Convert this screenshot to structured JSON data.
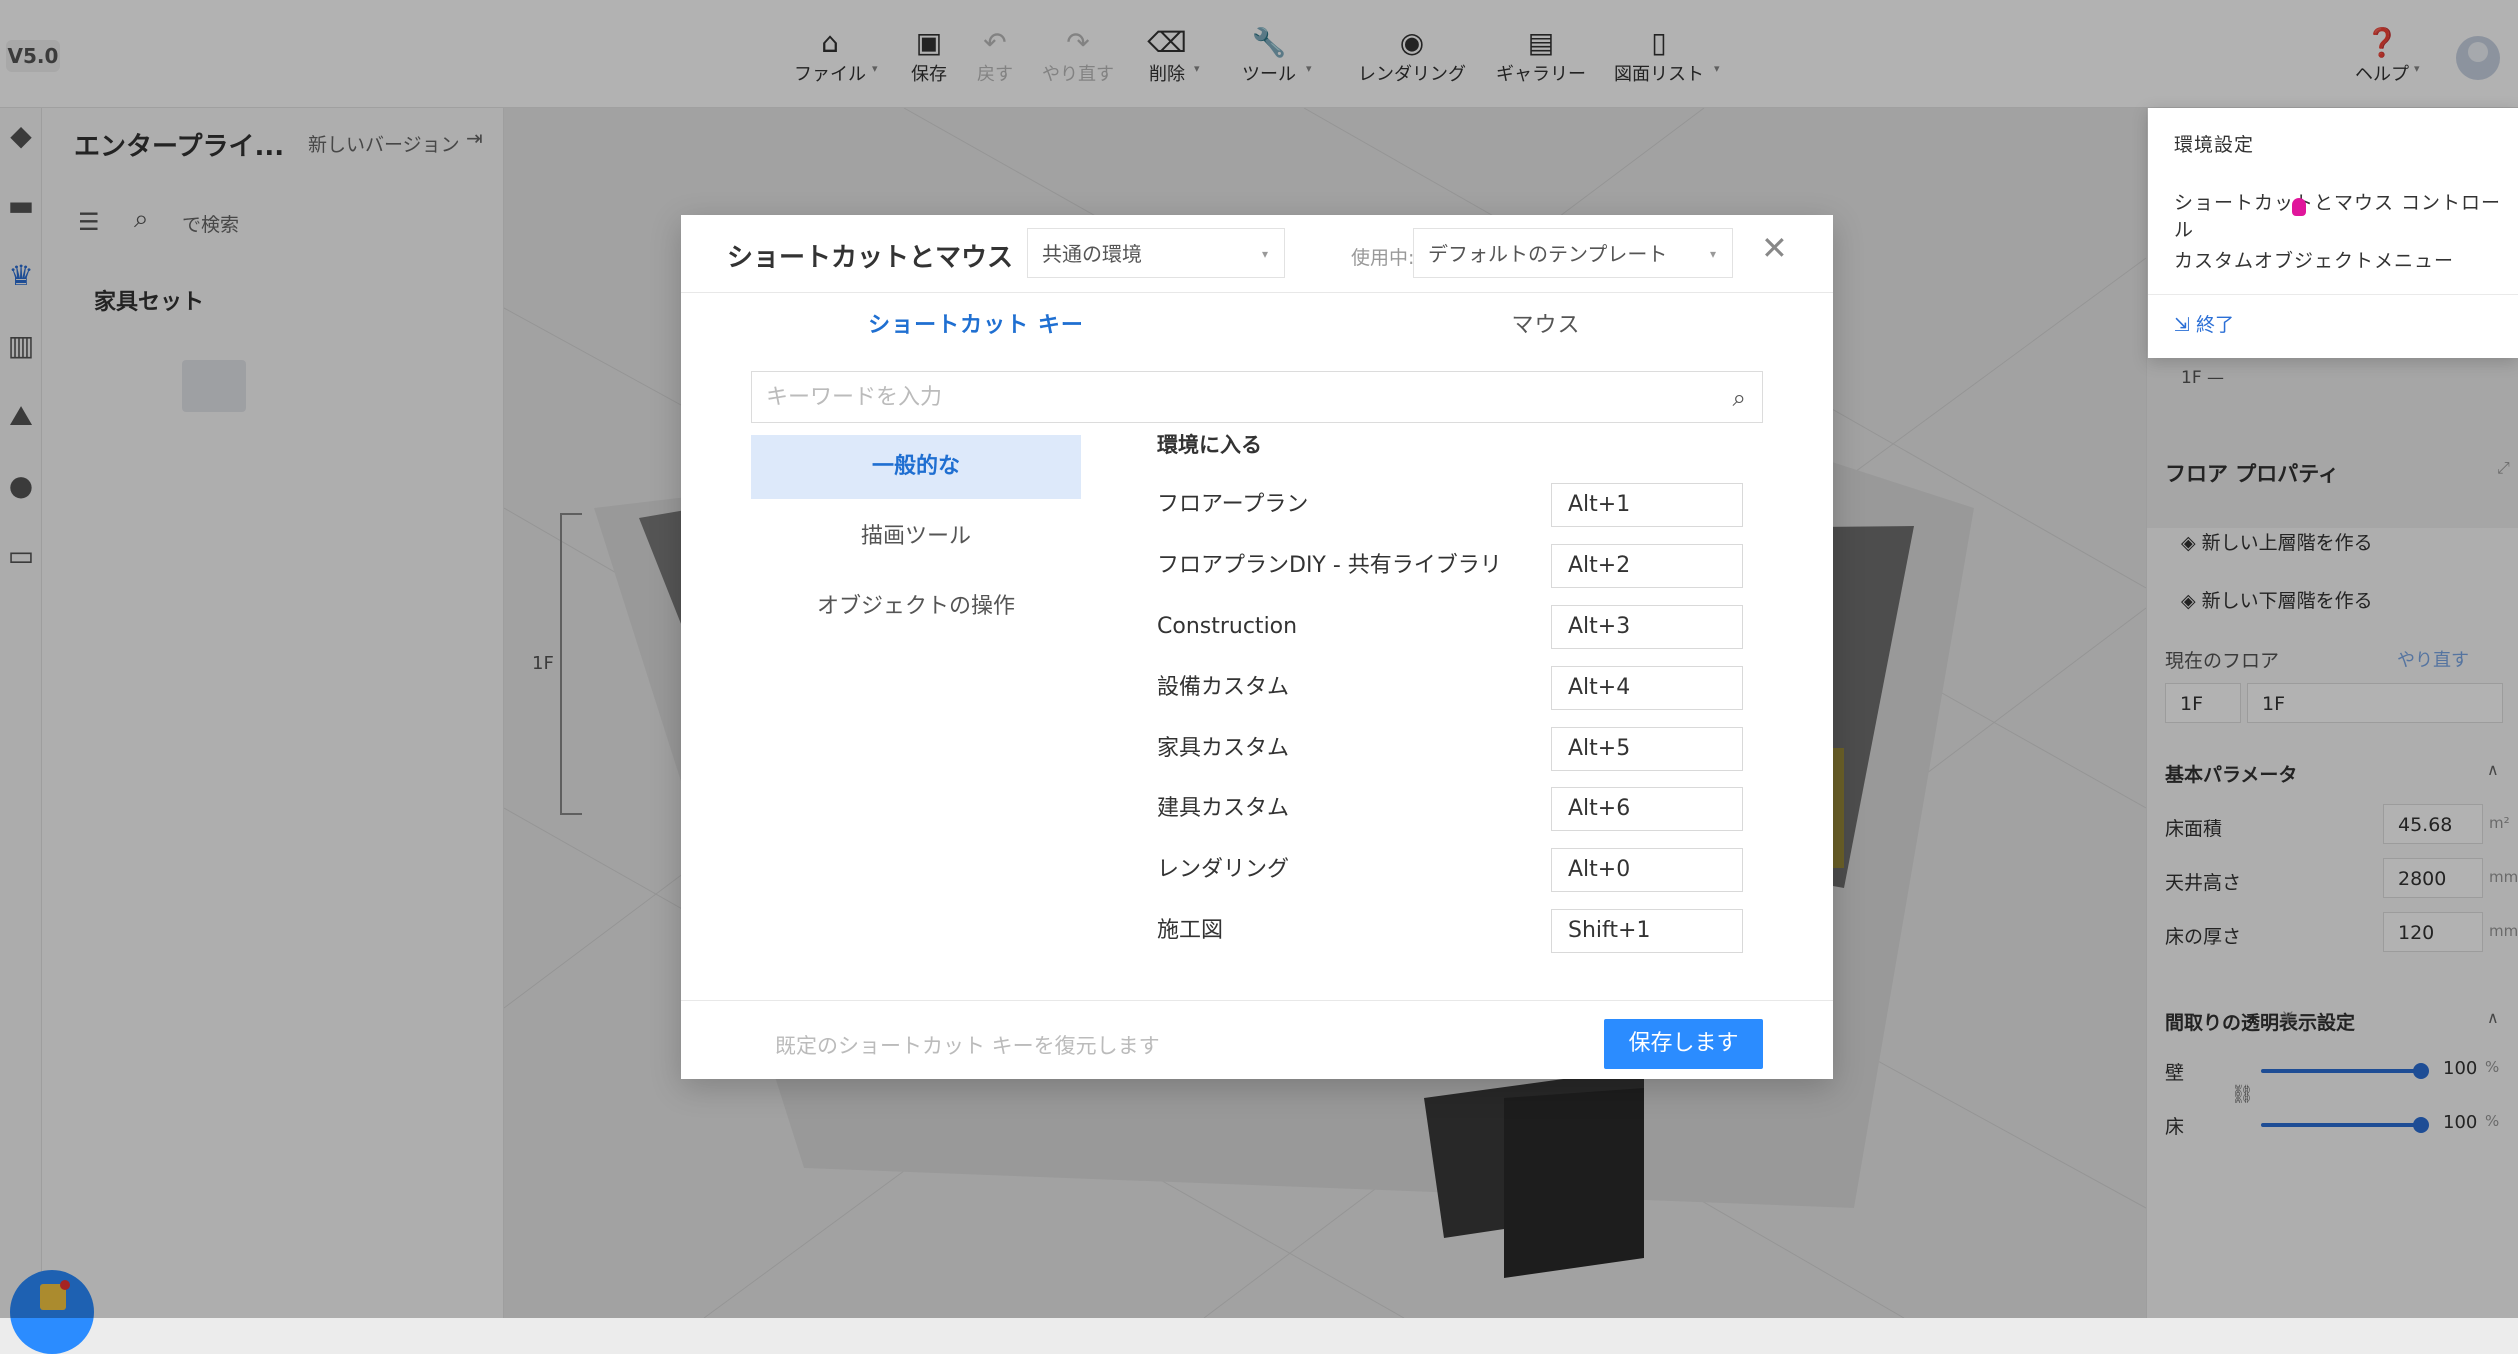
{
  "app": {
    "version": "V5.0"
  },
  "toolbar": {
    "items": [
      {
        "label": "ファイル",
        "icon": "home-icon",
        "enabled": true
      },
      {
        "label": "保存",
        "icon": "save-icon",
        "enabled": true
      },
      {
        "label": "戻す",
        "icon": "undo-icon",
        "enabled": false
      },
      {
        "label": "やり直す",
        "icon": "redo-icon",
        "enabled": false
      },
      {
        "label": "削除",
        "icon": "eraser-icon",
        "enabled": true
      },
      {
        "label": "ツール",
        "icon": "wrench-icon",
        "enabled": true
      },
      {
        "label": "レンダリング",
        "icon": "camera-icon",
        "enabled": true
      },
      {
        "label": "ギャラリー",
        "icon": "gallery-icon",
        "enabled": true
      },
      {
        "label": "図面リスト",
        "icon": "drawing-list-icon",
        "enabled": true
      }
    ],
    "help_label": "ヘルプ"
  },
  "left_panel": {
    "title": "エンタープライ...",
    "new_version": "新しいバージョン",
    "search_placeholder": "で検索",
    "section_title": "家具セット"
  },
  "canvas": {
    "floor_label": "1F"
  },
  "right_panel": {
    "level_label": "1F —",
    "floor_properties_title": "フロア プロパティ",
    "add_upper_floor": "新しい上層階を作る",
    "add_lower_floor": "新しい下層階を作る",
    "current_floor_label": "現在のフロア",
    "redo_label": "やり直す",
    "floor_select": "1F",
    "floor_name": "1F",
    "basic_params_title": "基本パラメータ",
    "params": [
      {
        "label": "床面積",
        "value": "45.68",
        "unit": "m²"
      },
      {
        "label": "天井高さ",
        "value": "2800",
        "unit": "mm"
      },
      {
        "label": "床の厚さ",
        "value": "120",
        "unit": "mm"
      }
    ],
    "transparency_title": "間取りの透明表示設定",
    "transparency_flag": "Y",
    "transparency": [
      {
        "label": "壁",
        "value": "100",
        "unit": "%",
        "level": 1.0
      },
      {
        "label": "床",
        "value": "100",
        "unit": "%",
        "level": 1.0
      }
    ]
  },
  "help_menu": {
    "items": [
      "環境設定",
      "ショートカットとマウス コントロール",
      "カスタムオブジェクトメニュー"
    ],
    "exit_label": "終了"
  },
  "modal": {
    "title": "ショートカットとマウス",
    "environment_select": "共通の環境",
    "in_use_label": "使用中:",
    "template_select": "デフォルトのテンプレート",
    "tabs": [
      "ショートカット キー",
      "マウス"
    ],
    "active_tab": 0,
    "search_placeholder": "キーワードを入力",
    "categories": [
      "一般的な",
      "描画ツール",
      "オブジェクトの操作"
    ],
    "active_category": 0,
    "section_title": "環境に入る",
    "shortcuts": [
      {
        "label": "フロアープラン",
        "key": "Alt+1"
      },
      {
        "label": "フロアプランDIY - 共有ライブラリ",
        "key": "Alt+2"
      },
      {
        "label": "Construction",
        "key": "Alt+3"
      },
      {
        "label": "設備カスタム",
        "key": "Alt+4"
      },
      {
        "label": "家具カスタム",
        "key": "Alt+5"
      },
      {
        "label": "建具カスタム",
        "key": "Alt+6"
      },
      {
        "label": "レンダリング",
        "key": "Alt+0"
      },
      {
        "label": "施工図",
        "key": "Shift+1"
      }
    ],
    "restore_label": "既定のショートカット キーを復元します",
    "save_label": "保存します"
  },
  "colors": {
    "accent": "#2b8cff",
    "active_tab": "#1f6fd1",
    "active_category_bg": "#dde9fa",
    "cursor": "#e0169b"
  }
}
